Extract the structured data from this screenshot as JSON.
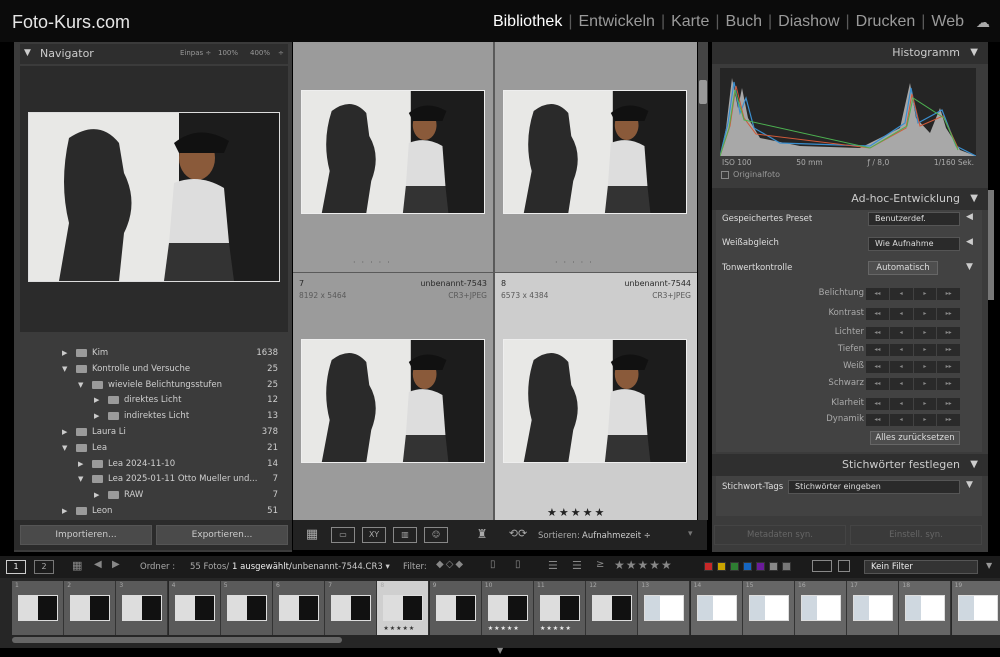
{
  "app": {
    "logo": "Foto-Kurs.com"
  },
  "modules": [
    {
      "label": "Bibliothek",
      "active": true
    },
    {
      "label": "Entwickeln"
    },
    {
      "label": "Karte"
    },
    {
      "label": "Buch"
    },
    {
      "label": "Diashow"
    },
    {
      "label": "Drucken"
    },
    {
      "label": "Web"
    }
  ],
  "navigator": {
    "title": "Navigator",
    "zoom": [
      "Einpas ÷",
      "100%",
      "400%",
      "÷"
    ]
  },
  "folders": [
    {
      "label": "Kim",
      "count": "1638",
      "depth": 0,
      "open": false
    },
    {
      "label": "Kontrolle und Versuche",
      "count": "25",
      "depth": 0,
      "open": true
    },
    {
      "label": "wieviele Belichtungsstufen",
      "count": "25",
      "depth": 1,
      "open": true
    },
    {
      "label": "direktes Licht",
      "count": "12",
      "depth": 2,
      "open": false
    },
    {
      "label": "indirektes Licht",
      "count": "13",
      "depth": 2,
      "open": false
    },
    {
      "label": "Laura Li",
      "count": "378",
      "depth": 0,
      "open": false
    },
    {
      "label": "Lea",
      "count": "21",
      "depth": 0,
      "open": true
    },
    {
      "label": "Lea 2024-11-10",
      "count": "14",
      "depth": 1,
      "open": false
    },
    {
      "label": "Lea 2025-01-11 Otto Mueller und...",
      "count": "7",
      "depth": 1,
      "open": true
    },
    {
      "label": "RAW",
      "count": "7",
      "depth": 2,
      "open": false
    },
    {
      "label": "Leon",
      "count": "51",
      "depth": 0,
      "open": false
    }
  ],
  "left_buttons": {
    "import": "Importieren...",
    "export": "Exportieren..."
  },
  "grid": [
    {
      "num": "",
      "name": "",
      "dim": "",
      "type": "",
      "selected": false,
      "stars": ""
    },
    {
      "num": "",
      "name": "",
      "dim": "",
      "type": "",
      "selected": false,
      "stars": ""
    },
    {
      "num": "7",
      "name": "unbenannt-7543",
      "dim": "8192 x 5464",
      "type": "CR3+JPEG",
      "selected": false,
      "stars": ""
    },
    {
      "num": "8",
      "name": "unbenannt-7544",
      "dim": "6573 x 4384",
      "type": "CR3+JPEG",
      "selected": true,
      "stars": "★★★★★"
    }
  ],
  "toolbar": {
    "sort_label": "Sortieren:",
    "sort_value": "Aufnahmezeit ÷"
  },
  "right": {
    "histogram_title": "Histogramm",
    "exif": [
      "ISO 100",
      "50 mm",
      "ƒ / 8,0",
      "1/160 Sek."
    ],
    "original_photo": "Originalfoto",
    "quick_develop_title": "Ad-hoc-Entwicklung",
    "saved_preset_label": "Gespeichertes Preset",
    "saved_preset_value": "Benutzerdef.",
    "wb_label": "Weißabgleich",
    "wb_value": "Wie Aufnahme",
    "tone_label": "Tonwertkontrolle",
    "auto_btn": "Automatisch",
    "sliders": [
      "Belichtung",
      "Kontrast",
      "Lichter",
      "Tiefen",
      "Weiß",
      "Schwarz",
      "Klarheit",
      "Dynamik"
    ],
    "reset_btn": "Alles zurücksetzen",
    "keywords_title": "Stichwörter festlegen",
    "keyword_tags_label": "Stichwort-Tags",
    "keyword_tags_value": "Stichwörter eingeben",
    "sync_meta": "Metadaten syn.",
    "sync_settings": "Einstell. syn."
  },
  "filterbar": {
    "view1": "1",
    "view2": "2",
    "source_prefix": "Ordner :",
    "source_count": "55 Fotos/",
    "source_sel": "1 ausgewählt/",
    "source_file": "unbenannt-7544.CR3 ▾",
    "filter_label": "Filter:",
    "filter_value": "Kein Filter",
    "colors": [
      "#c62828",
      "#c9a400",
      "#2e7d32",
      "#1565c0",
      "#6a1b9a",
      "#888888",
      "#777777"
    ]
  },
  "filmstrip": [
    {
      "n": "1",
      "stars": ""
    },
    {
      "n": "2",
      "stars": ""
    },
    {
      "n": "3",
      "stars": ""
    },
    {
      "n": "4",
      "stars": ""
    },
    {
      "n": "5",
      "stars": ""
    },
    {
      "n": "6",
      "stars": ""
    },
    {
      "n": "7",
      "stars": ""
    },
    {
      "n": "8",
      "stars": "★★★★★"
    },
    {
      "n": "9",
      "stars": ""
    },
    {
      "n": "10",
      "stars": "★★★★★"
    },
    {
      "n": "11",
      "stars": "★★★★★"
    },
    {
      "n": "12",
      "stars": ""
    },
    {
      "n": "13",
      "stars": ""
    },
    {
      "n": "14",
      "stars": ""
    },
    {
      "n": "15",
      "stars": ""
    },
    {
      "n": "16",
      "stars": ""
    },
    {
      "n": "17",
      "stars": ""
    },
    {
      "n": "18",
      "stars": ""
    },
    {
      "n": "19",
      "stars": ""
    }
  ]
}
